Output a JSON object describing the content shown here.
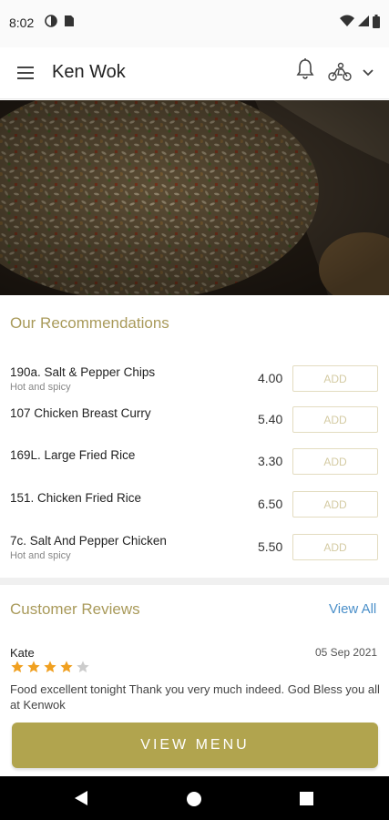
{
  "status_bar": {
    "time": "8:02"
  },
  "app_bar": {
    "title": "Ken Wok",
    "icons": [
      "menu-icon",
      "bell-icon",
      "delivery-rider-icon",
      "chevron-down-icon"
    ]
  },
  "recommendations": {
    "title": "Our Recommendations",
    "items": [
      {
        "name": "190a. Salt & Pepper Chips",
        "subtitle": "Hot and spicy",
        "price": "4.00",
        "button": "ADD"
      },
      {
        "name": "107 Chicken Breast Curry",
        "subtitle": "",
        "price": "5.40",
        "button": "ADD"
      },
      {
        "name": "169L. Large Fried Rice",
        "subtitle": "",
        "price": "3.30",
        "button": "ADD"
      },
      {
        "name": "151. Chicken Fried Rice",
        "subtitle": "",
        "price": "6.50",
        "button": "ADD"
      },
      {
        "name": "7c. Salt And Pepper Chicken",
        "subtitle": "Hot and spicy",
        "price": "5.50",
        "button": "ADD"
      }
    ]
  },
  "reviews": {
    "title": "Customer Reviews",
    "view_all": "View All",
    "items": [
      {
        "name": "Kate",
        "date": "05 Sep 2021",
        "rating": 4,
        "max_rating": 5,
        "text": "Food excellent tonight Thank you very much indeed. God Bless you all at Kenwok"
      }
    ]
  },
  "view_menu_label": "VIEW MENU",
  "colors": {
    "accent_gold": "#b1a44e",
    "section_title": "#a99a5a",
    "link_blue": "#4a8fc9",
    "star_filled": "#f0a020",
    "star_empty": "#cccccc"
  }
}
